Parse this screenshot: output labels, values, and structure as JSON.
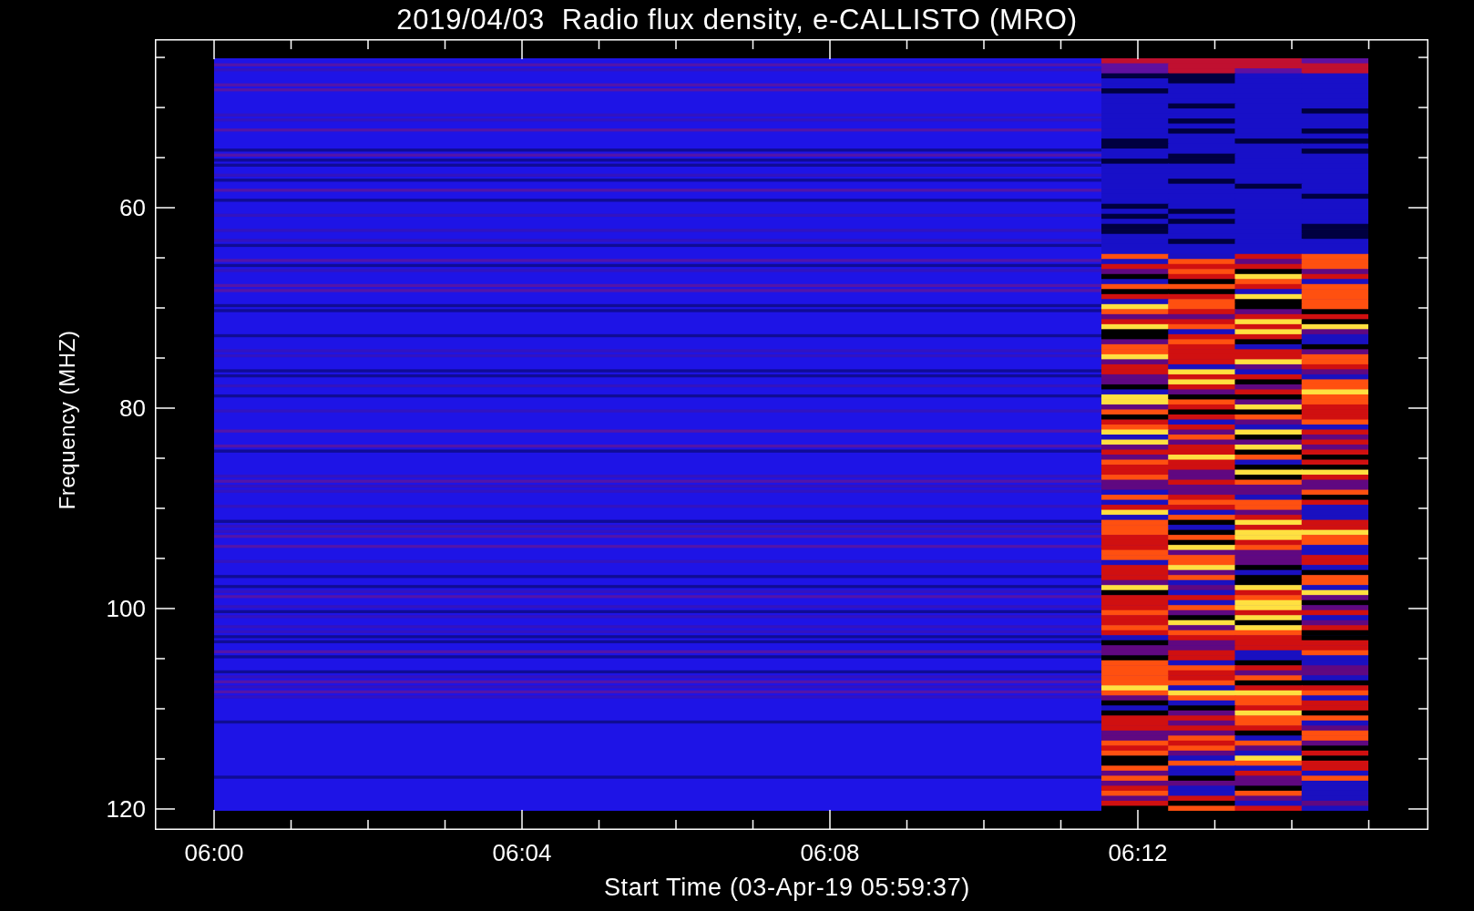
{
  "title": "2019/04/03  Radio flux density, e-CALLISTO (MRO)",
  "y_axis": {
    "label": "Frequency (MHZ)",
    "ticks": [
      "60",
      "80",
      "100",
      "120"
    ]
  },
  "x_axis": {
    "label": "Start Time (03-Apr-19 05:59:37)",
    "ticks": [
      "06:00",
      "06:04",
      "06:08",
      "06:12"
    ]
  }
}
